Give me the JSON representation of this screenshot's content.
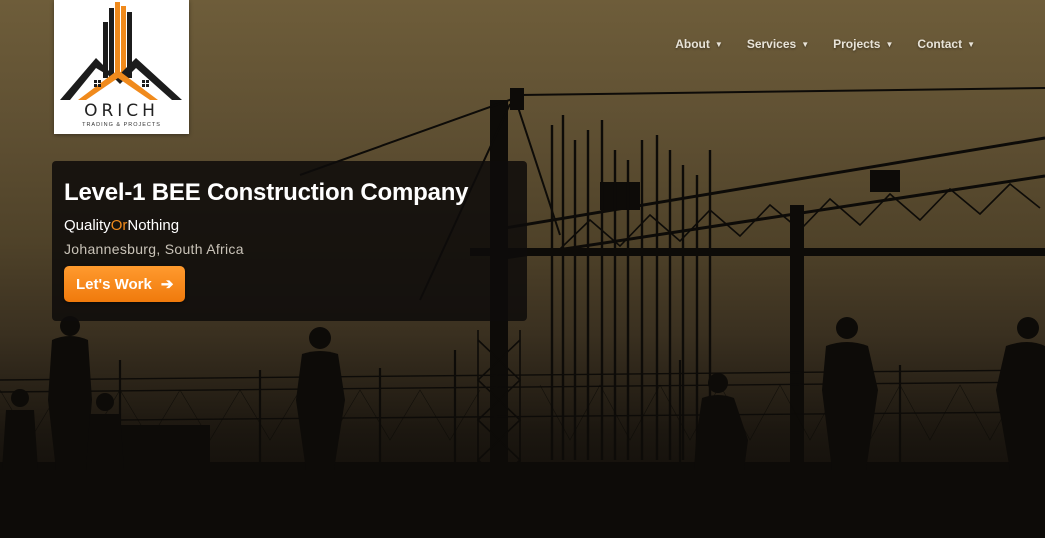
{
  "brand": {
    "name": "ORICH",
    "subtitle": "TRADING & PROJECTS",
    "colors": {
      "accent": "#f08a1c",
      "dark": "#222222"
    }
  },
  "nav": {
    "items": [
      {
        "label": "About",
        "icon": "caret-down-icon"
      },
      {
        "label": "Services",
        "icon": "caret-down-icon"
      },
      {
        "label": "Projects",
        "icon": "caret-down-icon"
      },
      {
        "label": "Contact",
        "icon": "caret-down-icon"
      }
    ],
    "caret": "▼"
  },
  "hero": {
    "headline": "Level-1 BEE Construction Company",
    "tagline": {
      "part1": "Quality",
      "part2": "Or",
      "part3": "Nothing"
    },
    "location": "Johannesburg, South Africa",
    "cta": {
      "label": "Let's Work",
      "icon": "arrow-right-icon",
      "arrow": "➔"
    },
    "background": "construction-site-silhouette-image"
  }
}
